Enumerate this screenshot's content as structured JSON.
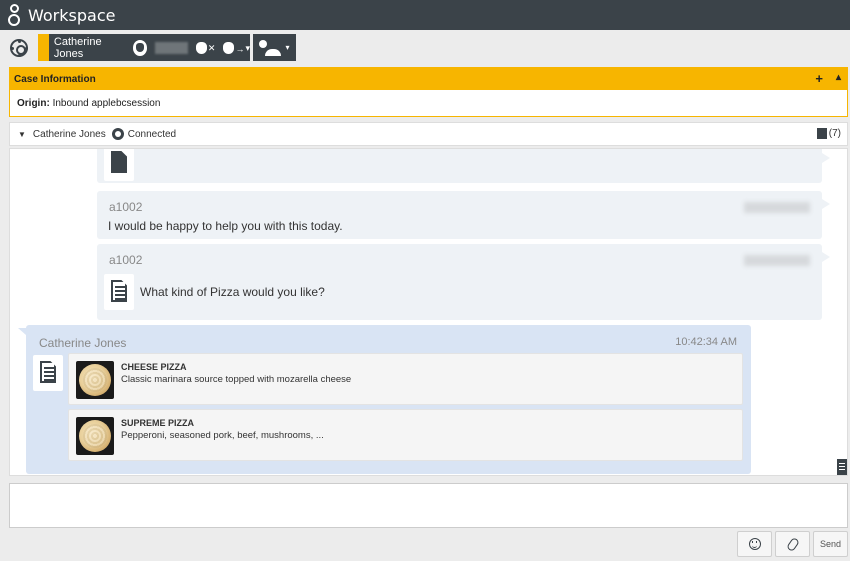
{
  "app": {
    "title": "Workspace"
  },
  "toolbar": {
    "party_name": "Catherine Jones",
    "apple_end_label": "✕",
    "apple_transfer_label": "→",
    "agent_menu": "▾"
  },
  "case": {
    "header": "Case Information",
    "add_label": "+",
    "collapse_label": "▴",
    "origin_label": "Origin:",
    "origin_value": "Inbound applebcsession"
  },
  "conversation": {
    "party": "Catherine Jones",
    "status": "Connected",
    "history_count": "(7)"
  },
  "messages": [
    {
      "from": "a1002",
      "text": "I would be happy to help you with this today."
    },
    {
      "from": "a1002",
      "text": "What kind of Pizza would you like?"
    }
  ],
  "customer_message": {
    "from": "Catherine Jones",
    "time": "10:42:34 AM",
    "items": [
      {
        "title": "CHEESE PIZZA",
        "desc": "Classic marinara source topped with mozarella cheese"
      },
      {
        "title": "SUPREME PIZZA",
        "desc": "Pepperoni, seasoned pork, beef, mushrooms, ..."
      }
    ]
  },
  "footer": {
    "send_label": "Send"
  },
  "colors": {
    "topbar": "#3b4349",
    "accent": "#f7b500",
    "agent_bubble": "#eef2f6",
    "customer_bubble": "#d9e4f4"
  },
  "icons": [
    "genesys-logo-icon",
    "gear-icon",
    "apple-icon",
    "apple-end-icon",
    "apple-transfer-icon",
    "agent-icon",
    "document-icon",
    "list-document-icon",
    "history-icon",
    "emoji-icon",
    "attachment-icon"
  ]
}
